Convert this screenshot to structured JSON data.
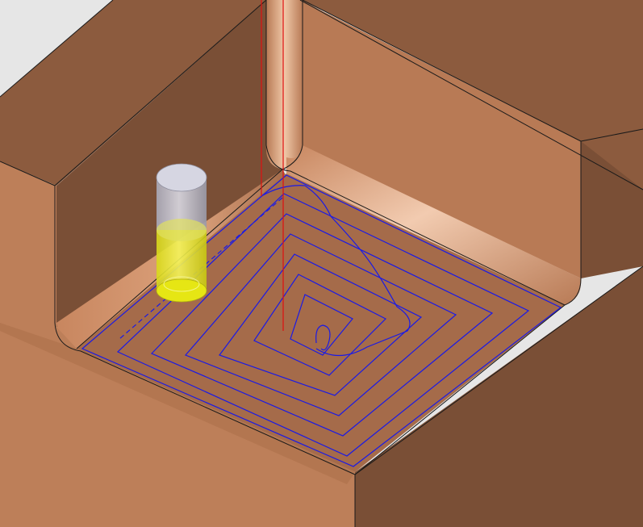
{
  "viewport": {
    "background": "#e6e6e6"
  },
  "colors": {
    "stock_top": "#8c5b3e",
    "stock_wall_dark": "#7a4f36",
    "stock_wall_mid": "#a36a48",
    "stock_face_light": "#bd7f59",
    "floor": "#a56b4a",
    "fillet_highlight": "#f0c8a8",
    "edge": "#1a1a1a",
    "toolpath": "#1a1ae6",
    "tool_axis": "#e01010",
    "tool_shank": "#c0c0cc",
    "tool_flute": "#e6e614"
  },
  "icons": {
    "tool": "end-mill-tool-icon"
  }
}
